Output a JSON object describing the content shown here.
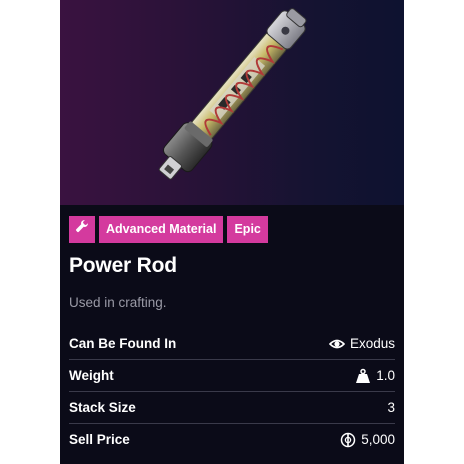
{
  "item": {
    "name": "Power Rod",
    "description": "Used in crafting.",
    "tags": [
      "Advanced Material",
      "Epic"
    ],
    "tag_icon": "wrench-icon",
    "colors": {
      "accent": "#d43a9e",
      "background": "#0b0b18"
    }
  },
  "stats": {
    "found_in": {
      "label": "Can Be Found In",
      "value": "Exodus",
      "icon": "eye-icon"
    },
    "weight": {
      "label": "Weight",
      "value": "1.0",
      "icon": "weight-icon"
    },
    "stack_size": {
      "label": "Stack Size",
      "value": "3"
    },
    "sell_price": {
      "label": "Sell Price",
      "value": "5,000",
      "icon": "coin-icon"
    }
  }
}
